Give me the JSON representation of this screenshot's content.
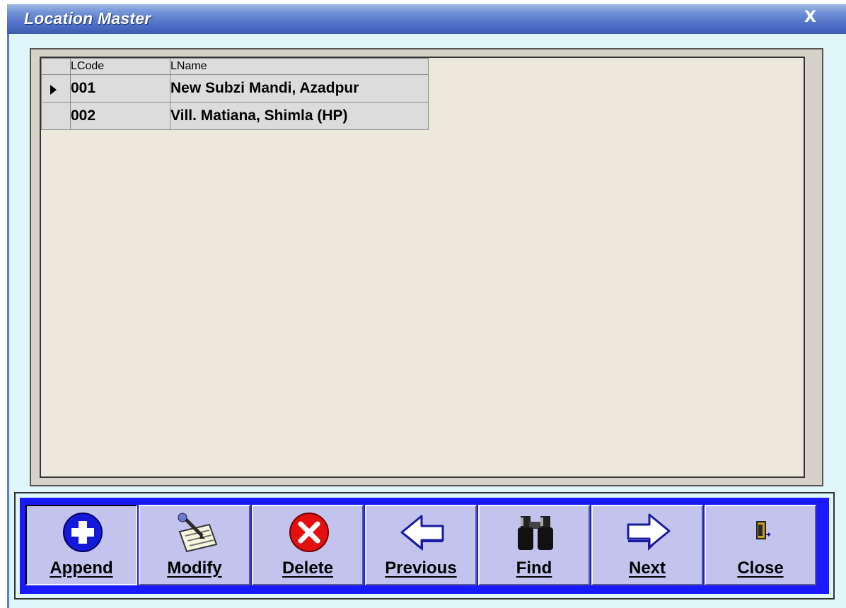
{
  "window": {
    "title": "Location Master",
    "close_glyph": "X"
  },
  "grid": {
    "columns": [
      "",
      "LCode",
      "LName"
    ],
    "rows": [
      {
        "current": true,
        "LCode": "001",
        "LName": "New Subzi Mandi, Azadpur"
      },
      {
        "current": false,
        "LCode": "002",
        "LName": "Vill. Matiana, Shimla (HP)"
      }
    ]
  },
  "toolbar": {
    "append": "Append",
    "modify": "Modify",
    "delete": "Delete",
    "previous": "Previous",
    "find": "Find",
    "next": "Next",
    "close": "Close"
  },
  "colors": {
    "titlebar": "#4d6fc6",
    "toolbar_border": "#1a1aff",
    "button_face": "#c2c4ee"
  },
  "icons": {
    "append": "plus-circle-icon",
    "modify": "pen-notepad-icon",
    "delete": "red-x-circle-icon",
    "previous": "left-arrow-icon",
    "find": "binoculars-icon",
    "next": "right-arrow-icon",
    "close": "exit-door-icon"
  }
}
